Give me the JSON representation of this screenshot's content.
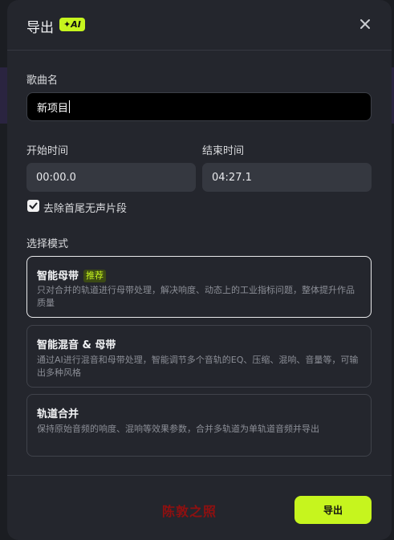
{
  "dialog": {
    "title": "导出",
    "ai_badge": "✦AI",
    "close_icon": "close-icon"
  },
  "song": {
    "label": "歌曲名",
    "value": "新项目"
  },
  "time": {
    "start_label": "开始时间",
    "start_value": "00:00.0",
    "end_label": "结束时间",
    "end_value": "04:27.1"
  },
  "trim_silence": {
    "label": "去除首尾无声片段",
    "checked": true
  },
  "modes": {
    "label": "选择模式",
    "items": [
      {
        "title": "智能母带",
        "badge": "推荐",
        "desc": "只对合并的轨道进行母带处理，解决响度、动态上的工业指标问题，整体提升作品质量",
        "selected": true
      },
      {
        "title": "智能混音 & 母带",
        "desc": "通过AI进行混音和母带处理，智能调节多个音轨的EQ、压缩、混响、音量等，可输出多种风格",
        "selected": false
      },
      {
        "title": "轨道合并",
        "desc": "保持原始音频的响度、混响等效果参数，合并多轨道为单轨道音频并导出",
        "selected": false
      }
    ]
  },
  "watermark": "陈敦之照",
  "footer": {
    "export_label": "导出"
  },
  "colors": {
    "accent": "#c6f51e",
    "dialog_bg": "#24262d"
  }
}
